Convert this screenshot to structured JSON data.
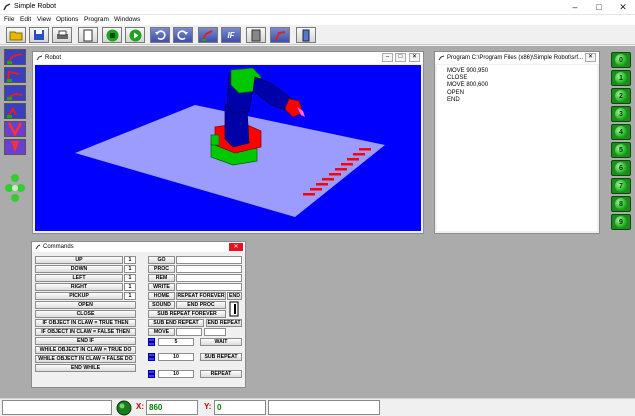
{
  "app": {
    "title": "Simple Robot"
  },
  "menu": [
    "File",
    "Edit",
    "View",
    "Options",
    "Program",
    "Windows"
  ],
  "toolbar": {
    "if_label": "IF"
  },
  "robot_window": {
    "title": "Robot"
  },
  "program_window": {
    "title": "Program C:\\Program Files (x86)\\Simple Robot\\srf...",
    "lines": [
      "MOVE 900,950",
      "CLOSE",
      "MOVE 800,600",
      "OPEN",
      "END"
    ]
  },
  "numpad": [
    "0",
    "1",
    "2",
    "3",
    "4",
    "5",
    "6",
    "7",
    "8",
    "9"
  ],
  "commands_window": {
    "title": "Commands",
    "motion": [
      {
        "label": "UP",
        "value": "1"
      },
      {
        "label": "DOWN",
        "value": "1"
      },
      {
        "label": "LEFT",
        "value": "1"
      },
      {
        "label": "RIGHT",
        "value": "1"
      },
      {
        "label": "PICKUP",
        "value": "1"
      }
    ],
    "open": "OPEN",
    "close": "CLOSE",
    "if_true": "IF OBJECT IN CLAW = TRUE THEN",
    "if_false": "IF OBJECT IN CLAW = FALSE THEN",
    "end_if": "END IF",
    "while_true": "WHILE OBJECT IN CLAW = TRUE DO",
    "while_false": "WHILE OBJECT IN CLAW = FALSE DO",
    "end_while": "END WHILE",
    "go": "GO",
    "proc": "PROC",
    "rem": "REM",
    "write": "WRITE",
    "home": "HOME",
    "repeat_forever": "REPEAT FOREVER",
    "end": "END",
    "sound": "SOUND",
    "end_proc": "END PROC",
    "sub_repeat_forever": "SUB REPEAT FOREVER",
    "sub_end_repeat": "SUB END REPEAT",
    "end_repeat": "END REPEAT",
    "move": "MOVE",
    "wait_value": "5",
    "wait": "WAIT",
    "sub_repeat_value": "10",
    "sub_repeat": "SUB REPEAT",
    "repeat_value": "10",
    "repeat": "REPEAT"
  },
  "status": {
    "x_label": "X:",
    "x_value": "860",
    "y_label": "Y:",
    "y_value": "0"
  },
  "colors": {
    "canvas": "#0000ff",
    "floor": "#9c9cff",
    "robot_green": "#00c800",
    "robot_red": "#ff0000",
    "robot_blue": "#0000a8"
  }
}
